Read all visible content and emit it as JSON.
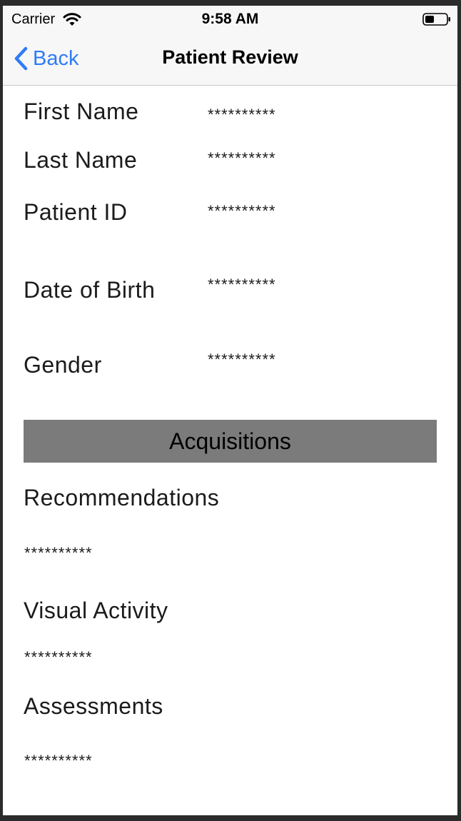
{
  "status_bar": {
    "carrier": "Carrier",
    "time": "9:58 AM",
    "icons": [
      "wifi-icon",
      "battery-icon"
    ]
  },
  "nav": {
    "back_label": "Back",
    "title": "Patient Review",
    "accent_color": "#2f7cf6"
  },
  "patient": {
    "first_name_label": "First Name",
    "first_name_value": "**********",
    "last_name_label": "Last Name",
    "last_name_value": "**********",
    "patient_id_label": "Patient ID",
    "patient_id_value": "**********",
    "dob_label": "Date of Birth",
    "dob_value": "**********",
    "gender_label": "Gender",
    "gender_value": "**********"
  },
  "acquisitions": {
    "header": "Acquisitions",
    "header_color": "#7b7b7b",
    "recommendations_label": "Recommendations",
    "recommendations_value": "**********",
    "visual_activity_label": "Visual Activity",
    "visual_activity_value": "**********",
    "assessments_label": "Assessments",
    "assessments_value": "**********"
  }
}
